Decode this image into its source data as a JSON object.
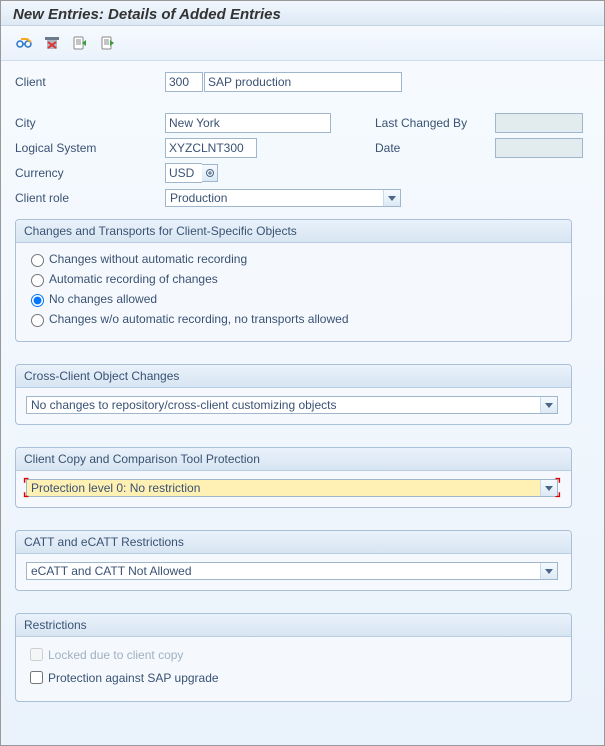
{
  "title": "New Entries: Details of Added Entries",
  "fields": {
    "client_label": "Client",
    "client_no": "300",
    "client_name": "SAP production",
    "city_label": "City",
    "city": "New York",
    "last_changed_by_label": "Last Changed By",
    "last_changed_by": "",
    "logical_system_label": "Logical System",
    "logical_system": "XYZCLNT300",
    "date_label": "Date",
    "date": "",
    "currency_label": "Currency",
    "currency": "USD",
    "client_role_label": "Client role",
    "client_role": "Production"
  },
  "groups": {
    "changes": {
      "title": "Changes and Transports for Client-Specific Objects",
      "options": [
        "Changes without automatic recording",
        "Automatic recording of changes",
        "No changes allowed",
        "Changes w/o automatic recording, no transports allowed"
      ],
      "selected": 2
    },
    "cross_client": {
      "title": "Cross-Client Object Changes",
      "value": "No changes to repository/cross-client customizing objects"
    },
    "copy_protect": {
      "title": "Client Copy and Comparison Tool Protection",
      "value": "Protection level 0: No restriction"
    },
    "catt": {
      "title": "CATT and eCATT Restrictions",
      "value": "eCATT and CATT Not Allowed"
    },
    "restrictions": {
      "title": "Restrictions",
      "locked_label": "Locked due to client copy",
      "upgrade_label": "Protection against SAP upgrade"
    }
  }
}
